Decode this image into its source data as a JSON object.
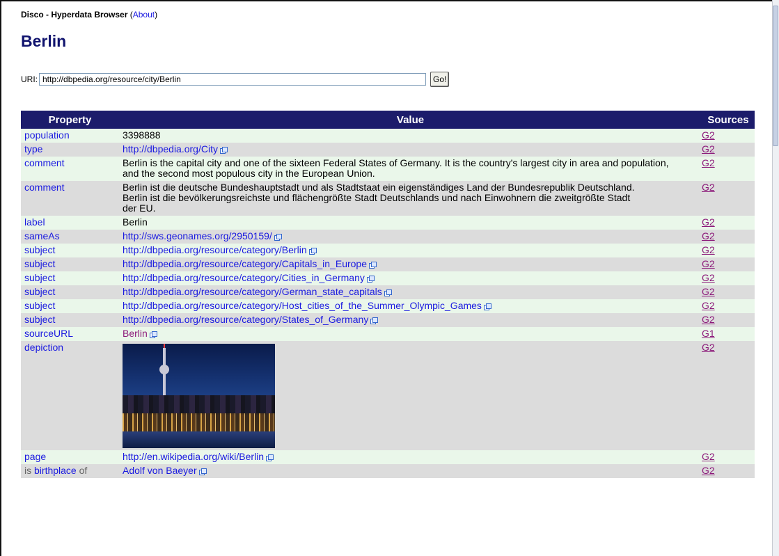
{
  "app": {
    "title": "Disco - Hyperdata Browser",
    "about_open": "(",
    "about_label": "About",
    "about_close": ")"
  },
  "page_title": "Berlin",
  "uri": {
    "label": "URI:",
    "value": "http://dbpedia.org/resource/city/Berlin",
    "go_label": "Go!"
  },
  "table": {
    "headers": {
      "property": "Property",
      "value": "Value",
      "sources": "Sources"
    },
    "rows": [
      {
        "property": "population",
        "value": "3398888",
        "source": "G2"
      },
      {
        "property": "type",
        "value": "http://dbpedia.org/City",
        "source": "G2"
      },
      {
        "property": "comment",
        "value": "Berlin is the capital city and one of the sixteen Federal States of Germany. It is the country's largest city in area and population, and the second most populous city in the European Union.",
        "source": "G2"
      },
      {
        "property": "comment",
        "value": "Berlin ist die deutsche Bundeshauptstadt und als Stadtstaat ein eigenständiges Land der Bundesrepublik Deutschland. Berlin ist die bevölkerungsreichste und flächengrößte Stadt Deutschlands und nach Einwohnern die zweitgrößte Stadt der EU.",
        "source": "G2"
      },
      {
        "property": "label",
        "value": "Berlin",
        "source": "G2"
      },
      {
        "property": "sameAs",
        "value": "http://sws.geonames.org/2950159/",
        "source": "G2"
      },
      {
        "property": "subject",
        "value": "http://dbpedia.org/resource/category/Berlin",
        "source": "G2"
      },
      {
        "property": "subject",
        "value": "http://dbpedia.org/resource/category/Capitals_in_Europe",
        "source": "G2"
      },
      {
        "property": "subject",
        "value": "http://dbpedia.org/resource/category/Cities_in_Germany",
        "source": "G2"
      },
      {
        "property": "subject",
        "value": "http://dbpedia.org/resource/category/German_state_capitals",
        "source": "G2"
      },
      {
        "property": "subject",
        "value": "http://dbpedia.org/resource/category/Host_cities_of_the_Summer_Olympic_Games",
        "source": "G2"
      },
      {
        "property": "subject",
        "value": "http://dbpedia.org/resource/category/States_of_Germany",
        "source": "G2"
      },
      {
        "property": "sourceURL",
        "value": "Berlin",
        "source": "G1"
      },
      {
        "property": "depiction",
        "value": "",
        "source": "G2"
      },
      {
        "property": "page",
        "value": "http://en.wikipedia.org/wiki/Berlin",
        "source": "G2"
      },
      {
        "property_prefix": "is",
        "property": "birthplace",
        "property_suffix": "of",
        "value": "Adolf von Baeyer",
        "source": "G2"
      }
    ]
  },
  "colors": {
    "header_bg": "#1c1c6b",
    "title": "#10136e",
    "link": "#1a1ae0",
    "visited": "#8c1a7a",
    "row_odd": "#eaf7ea",
    "row_even": "#dcdcdc"
  },
  "icons": {
    "external_link": "external-link-icon"
  }
}
